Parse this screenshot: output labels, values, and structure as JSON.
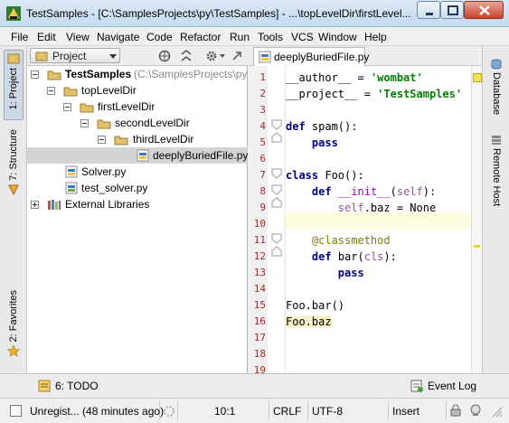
{
  "window": {
    "title": "TestSamples - [C:\\SamplesProjects\\py\\TestSamples] - ...\\topLevelDir\\firstLevel..."
  },
  "menu": [
    "File",
    "Edit",
    "View",
    "Navigate",
    "Code",
    "Refactor",
    "Run",
    "Tools",
    "VCS",
    "Window",
    "Help"
  ],
  "left_tools": {
    "project": "1: Project",
    "structure": "7: Structure",
    "favorites": "2: Favorites"
  },
  "right_tools": {
    "database": "Database",
    "remote_host": "Remote Host"
  },
  "project_panel": {
    "view_selector": "Project",
    "tree": [
      {
        "label": "TestSamples",
        "path": "(C:\\SamplesProjects\\py\\Te",
        "type": "folder"
      },
      {
        "label": "topLevelDir",
        "type": "folder"
      },
      {
        "label": "firstLevelDir",
        "type": "folder"
      },
      {
        "label": "secondLevelDir",
        "type": "folder"
      },
      {
        "label": "thirdLevelDir",
        "type": "folder"
      },
      {
        "label": "deeplyBuriedFile.py",
        "type": "python"
      },
      {
        "label": "Solver.py",
        "type": "python"
      },
      {
        "label": "test_solver.py",
        "type": "python"
      },
      {
        "label": "External Libraries",
        "type": "library"
      }
    ]
  },
  "editor": {
    "tab_label": "deeplyBuriedFile.py",
    "line_numbers": [
      "1",
      "2",
      "3",
      "4",
      "5",
      "6",
      "7",
      "8",
      "9",
      "10",
      "11",
      "12",
      "13",
      "14",
      "15",
      "16",
      "17",
      "18",
      "19"
    ],
    "code": {
      "l1_name": "__author__",
      "l1_eq": " = ",
      "l1_val": "'wombat'",
      "l2_name": "__project__",
      "l2_eq": " = ",
      "l2_val": "'TestSamples'",
      "l4_kw": "def",
      "l4_rest": " spam():",
      "l5_kw": "pass",
      "l7_kw": "class",
      "l7_rest": " Foo():",
      "l8_kw": "def",
      "l8_name": "__init__",
      "l8_open": "(",
      "l8_self": "self",
      "l8_close": "):",
      "l9_self": "self",
      "l9_rest": ".baz = None",
      "l11_deco": "@classmethod",
      "l12_kw": "def",
      "l12_name": " bar(",
      "l12_cls": "cls",
      "l12_close": "):",
      "l13_kw": "pass",
      "l15_text": "Foo.bar()",
      "l16_text": "Foo.baz"
    }
  },
  "bottom_tools": {
    "todo": "6: TODO",
    "event_log": "Event Log"
  },
  "status": {
    "message": "Unregist... (48 minutes ago)",
    "position": "10:1",
    "line_sep": "CRLF",
    "encoding": "UTF-8",
    "mode": "Insert"
  }
}
